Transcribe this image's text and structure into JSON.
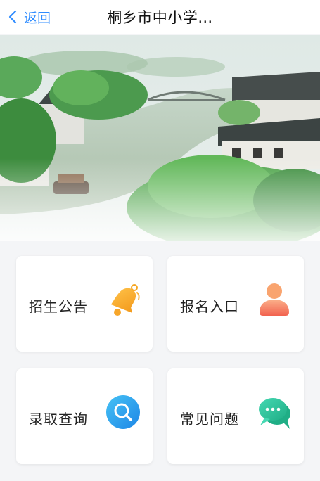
{
  "header": {
    "back_label": "返回",
    "title": "桐乡市中小学…"
  },
  "menu": [
    {
      "label": "招生公告",
      "icon": "bell-icon",
      "color": "#f5a623"
    },
    {
      "label": "报名入口",
      "icon": "user-icon",
      "color": "#f46a5a"
    },
    {
      "label": "录取查询",
      "icon": "search-icon",
      "color": "#2fa3f0"
    },
    {
      "label": "常见问题",
      "icon": "chat-bubble-icon",
      "color": "#2dc49a"
    }
  ]
}
